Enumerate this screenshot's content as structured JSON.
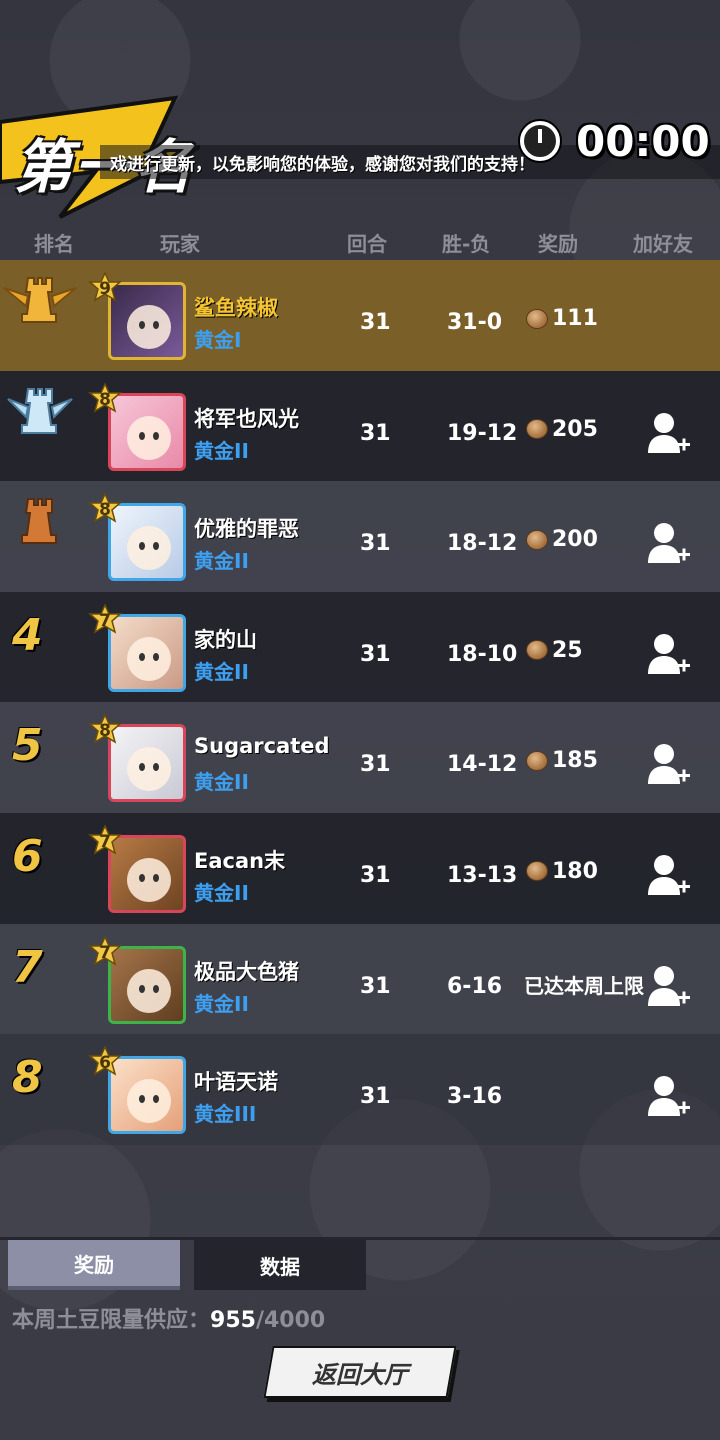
{
  "header": {
    "rank_title": "第一名",
    "notice": "戏进行更新，以免影响您的体验，感谢您对我们的支持！",
    "timer": "00:00"
  },
  "columns": {
    "rank": "排名",
    "player": "玩家",
    "rounds": "回合",
    "win_loss": "胜-负",
    "reward": "奖励",
    "add_friend": "加好友"
  },
  "rows": [
    {
      "rank": "",
      "medal": "gold",
      "level": "9",
      "name": "鲨鱼辣椒",
      "tier": "黄金I",
      "rounds": "31",
      "wl": "31-0",
      "reward": "111",
      "reward_note": "",
      "add_friend": false
    },
    {
      "rank": "",
      "medal": "silver",
      "level": "8",
      "name": "将军也风光",
      "tier": "黄金II",
      "rounds": "31",
      "wl": "19-12",
      "reward": "205",
      "reward_note": "",
      "add_friend": true
    },
    {
      "rank": "",
      "medal": "bronze",
      "level": "8",
      "name": "优雅的罪恶",
      "tier": "黄金II",
      "rounds": "31",
      "wl": "18-12",
      "reward": "200",
      "reward_note": "",
      "add_friend": true
    },
    {
      "rank": "4",
      "medal": "",
      "level": "7",
      "name": "家的山",
      "tier": "黄金II",
      "rounds": "31",
      "wl": "18-10",
      "reward": "25",
      "reward_note": "",
      "add_friend": true
    },
    {
      "rank": "5",
      "medal": "",
      "level": "8",
      "name": "Sugarcated",
      "tier": "黄金II",
      "rounds": "31",
      "wl": "14-12",
      "reward": "185",
      "reward_note": "",
      "add_friend": true
    },
    {
      "rank": "6",
      "medal": "",
      "level": "7",
      "name": "Eacan末",
      "tier": "黄金II",
      "rounds": "31",
      "wl": "13-13",
      "reward": "180",
      "reward_note": "",
      "add_friend": true
    },
    {
      "rank": "7",
      "medal": "",
      "level": "7",
      "name": "极品大色猪",
      "tier": "黄金II",
      "rounds": "31",
      "wl": "6-16",
      "reward": "",
      "reward_note": "已达本周上限",
      "add_friend": true
    },
    {
      "rank": "8",
      "medal": "",
      "level": "6",
      "name": "叶语天诺",
      "tier": "黄金III",
      "rounds": "31",
      "wl": "3-16",
      "reward": "",
      "reward_note": "",
      "add_friend": true
    }
  ],
  "tabs": {
    "reward": "奖励",
    "data": "数据"
  },
  "supply": {
    "label": "本周土豆限量供应：",
    "current": "955",
    "max": "/4000"
  },
  "back_button": "返回大厅"
}
